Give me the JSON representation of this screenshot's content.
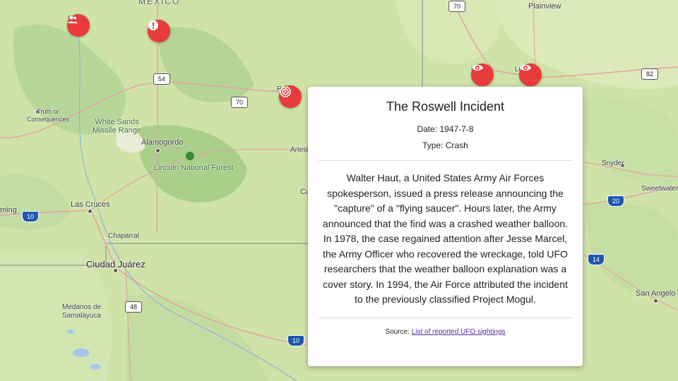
{
  "map": {
    "labels": {
      "mexico": "MEXICO",
      "plainview": "Plainview",
      "truth_or_consequences": "Truth or\nConsequences",
      "white_sands": "White Sands\nMissile Range",
      "alamogordo": "Alamogordo",
      "lincoln_forest": "Lincoln National Forest",
      "artesia": "Artesi",
      "carlsbad": "Ca",
      "las_cruces": "Las Cruces",
      "deming": "ming",
      "chaparral": "Chaparral",
      "ciudad_juarez": "Ciudad Juárez",
      "medanos": "Medanos de\nSamalayuca",
      "snyder": "Snyder",
      "sweetwater": "Sweetwater",
      "san_angelo": "San Angelo",
      "lubbock_partial": "Lu    ck",
      "levelland_partial": "L      d",
      "roswell_partial": "R     ll",
      "socorro_partial": "o"
    },
    "shields": {
      "us70_top": "70",
      "nm54": "54",
      "us70": "70",
      "us82": "82",
      "i10_west": "10",
      "i10_east": "10",
      "i20": "20",
      "i14": "14",
      "nm48": "48"
    },
    "markers": [
      {
        "name": "group-icon",
        "type": "group"
      },
      {
        "name": "alert-icon",
        "type": "alert"
      },
      {
        "name": "signal-icon",
        "type": "crash"
      },
      {
        "name": "eye-icon",
        "type": "sighting"
      },
      {
        "name": "eye-icon",
        "type": "sighting"
      }
    ]
  },
  "popup": {
    "title": "The Roswell Incident",
    "date": "Date: 1947-7-8",
    "type": "Type: Crash",
    "description": "Walter Haut, a United States Army Air Forces spokesperson, issued a press release announcing the \"capture\" of a \"flying saucer\". Hours later, the Army announced that the find was a crashed weather balloon. In 1978, the case regained attention after Jesse Marcel, the Army Officer who recovered the wreckage, told UFO researchers that the weather balloon explanation was a cover story. In 1994, the Air Force attributed the incident to the previously classified Project Mogul.",
    "source_prefix": "Source: ",
    "source_link": "List of reported UFO sightings"
  },
  "colors": {
    "marker": "#e83b3b",
    "map_base": "#cfe3a8",
    "link": "#5a2aa0"
  }
}
